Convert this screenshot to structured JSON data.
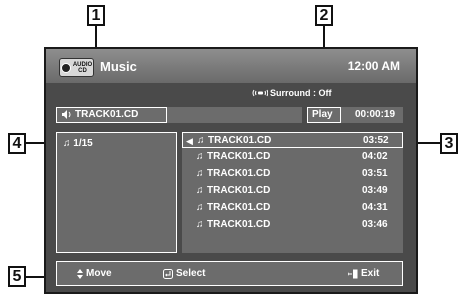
{
  "header": {
    "title": "Music",
    "clock": "12:00 AM",
    "cd_badge_lines": [
      "AUDIO",
      "CD"
    ]
  },
  "surround": {
    "text": "Surround : Off"
  },
  "now_playing": {
    "track": "TRACK01.CD",
    "status": "Play",
    "elapsed": "00:00:19"
  },
  "folder": {
    "count": "1/15"
  },
  "tracks": [
    {
      "name": "TRACK01.CD",
      "duration": "03:52"
    },
    {
      "name": "TRACK01.CD",
      "duration": "04:02"
    },
    {
      "name": "TRACK01.CD",
      "duration": "03:51"
    },
    {
      "name": "TRACK01.CD",
      "duration": "03:49"
    },
    {
      "name": "TRACK01.CD",
      "duration": "04:31"
    },
    {
      "name": "TRACK01.CD",
      "duration": "03:46"
    }
  ],
  "footer": {
    "move": "Move",
    "select": "Select",
    "exit": "Exit"
  },
  "callouts": [
    "1",
    "2",
    "3",
    "4",
    "5"
  ],
  "icons": {
    "speaker": "speaker-icon",
    "note": "music-note-icon",
    "play": "play-indicator-icon",
    "move": "up-down-arrow-icon",
    "select": "enter-icon",
    "exit": "exit-icon",
    "surround": "surround-icon",
    "disc": "cd-disc-icon"
  },
  "colors": {
    "screen_bg": "#4a4a4a",
    "panel_bg": "#6a6a6a",
    "text": "#ffffff"
  }
}
